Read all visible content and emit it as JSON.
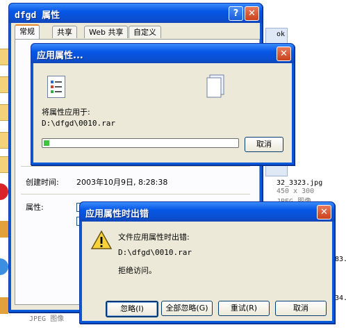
{
  "background": {
    "files": [
      {
        "name": "ok"
      },
      {
        "name": "32_3323.jpg",
        "dims": "450 x 300",
        "type": "JPEG 图像"
      },
      {
        "name": "JPEG 图像"
      }
    ],
    "fragments": [
      "83.",
      "34."
    ]
  },
  "properties_dialog": {
    "title": "dfgd 属性",
    "tabs": [
      "常规",
      "共享",
      "Web 共享",
      "自定义"
    ],
    "fields": [
      {
        "label": "创建时间:",
        "value": "2003年10月9日, 8:28:38"
      },
      {
        "label": "属性:",
        "value": ""
      }
    ]
  },
  "apply_dialog": {
    "title": "应用属性...",
    "message": "将属性应用于:",
    "path": "D:\\dfgd\\0010.rar",
    "progress": 0.03,
    "cancel_label": "取消"
  },
  "error_dialog": {
    "title": "应用属性时出错",
    "message": "文件应用属性时出错:",
    "path": "D:\\dfgd\\0010.rar",
    "detail": "拒绝访问。",
    "buttons": {
      "ignore": "忽略(I)",
      "ignore_all": "全部忽略(G)",
      "retry": "重试(R)",
      "cancel": "取消"
    }
  },
  "colors": {
    "titlebar": "#0a5ad8",
    "dialog_bg": "#ece9d8",
    "close": "#c9421c",
    "progress": "#3cc63c"
  }
}
